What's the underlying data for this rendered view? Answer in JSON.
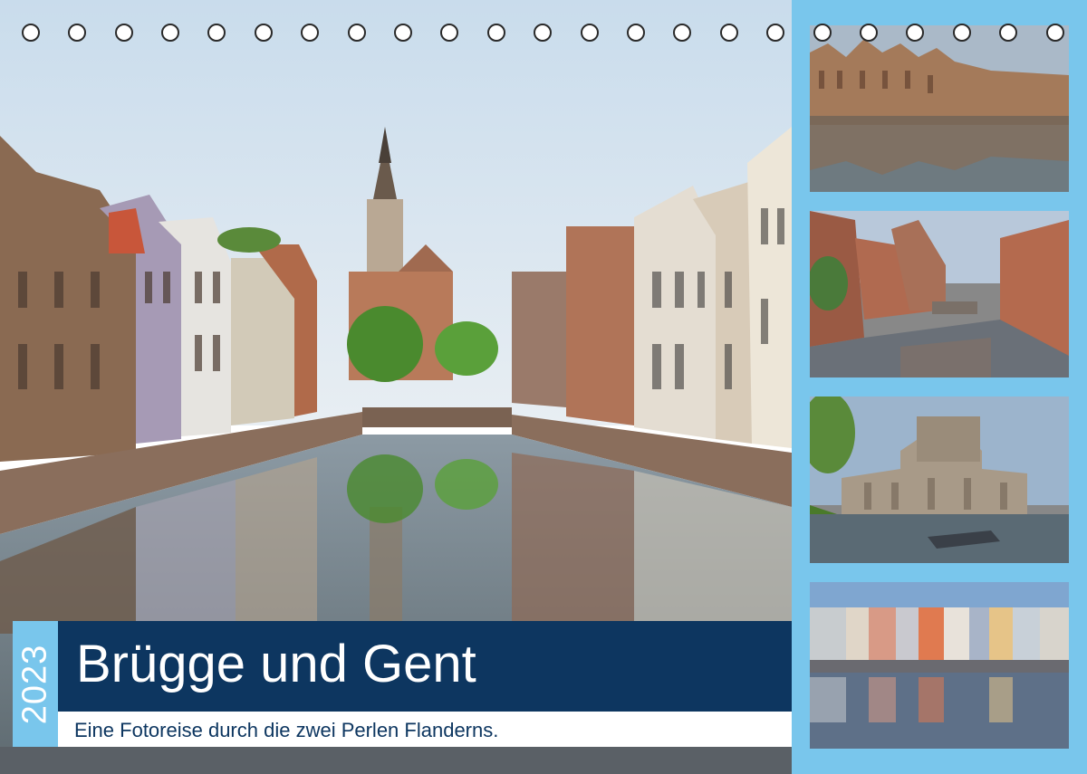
{
  "cover": {
    "year": "2023",
    "title": "Brügge und Gent",
    "subtitle": "Eine Fotoreise durch die zwei Perlen Flanderns."
  },
  "colors": {
    "accent": "#79c6ec",
    "title_bar": "#0d3660",
    "subtitle_text": "#0d3660",
    "binding_hole": "#ffffff"
  },
  "photos": {
    "main": "bruges-canal-photo",
    "thumbnails": [
      "ghent-graslei-photo",
      "bruges-canal-bridge-photo",
      "gravensteen-castle-photo",
      "ghent-waterfront-photo"
    ]
  }
}
